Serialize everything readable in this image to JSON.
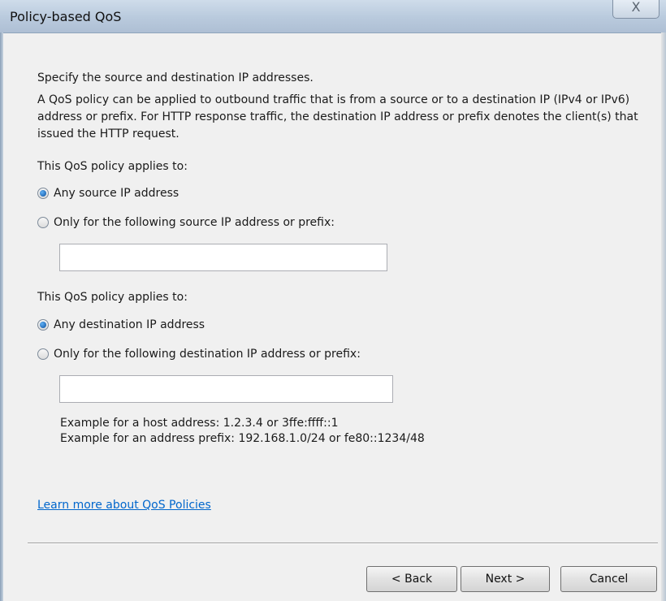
{
  "window": {
    "title": "Policy-based QoS",
    "close_glyph": "X"
  },
  "content": {
    "intro": "Specify the source and destination IP addresses.",
    "description": "A QoS policy can be applied to outbound traffic that is from a source or to a destination IP (IPv4 or IPv6) address or prefix. For HTTP response traffic, the destination IP address or prefix denotes the client(s) that issued the HTTP request.",
    "source_section": {
      "heading": "This QoS policy applies to:",
      "option_any": "Any source IP address",
      "option_specific": "Only for the following source IP address or prefix:",
      "selected": "any",
      "input_value": ""
    },
    "destination_section": {
      "heading": "This QoS policy applies to:",
      "option_any": "Any destination IP address",
      "option_specific": "Only for the following destination IP address or prefix:",
      "selected": "any",
      "input_value": ""
    },
    "example_host": "Example for a host address: 1.2.3.4 or 3ffe:ffff::1",
    "example_prefix": "Example for an address prefix: 192.168.1.0/24 or fe80::1234/48",
    "learn_more_link": "Learn more about QoS Policies"
  },
  "buttons": {
    "back": "< Back",
    "next": "Next >",
    "cancel": "Cancel"
  },
  "colors": {
    "link": "#0066cc",
    "radio_selected": "#0b4f9e"
  }
}
